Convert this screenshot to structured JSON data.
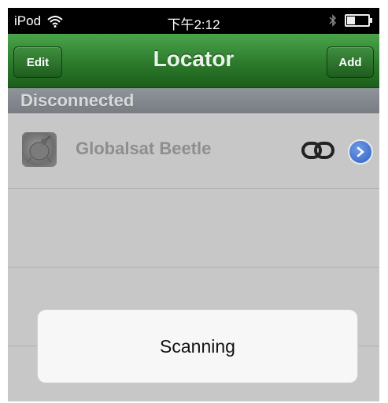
{
  "status_bar": {
    "carrier": "iPod",
    "time": "下午2:12",
    "battery_level": 0.4
  },
  "nav": {
    "title": "Locator",
    "edit_label": "Edit",
    "add_label": "Add"
  },
  "section": {
    "header": "Disconnected"
  },
  "devices": [
    {
      "name": "Globalsat Beetle"
    }
  ],
  "toast": {
    "message": "Scanning"
  },
  "icons": {
    "wifi": "wifi-icon",
    "bluetooth": "bluetooth-icon",
    "battery": "battery-icon",
    "device": "beetle-device-icon",
    "link": "link-icon",
    "disclosure": "disclosure-arrow-icon"
  },
  "colors": {
    "nav_green": "#2c7a2c",
    "disclosure_blue": "#2f61c4"
  }
}
